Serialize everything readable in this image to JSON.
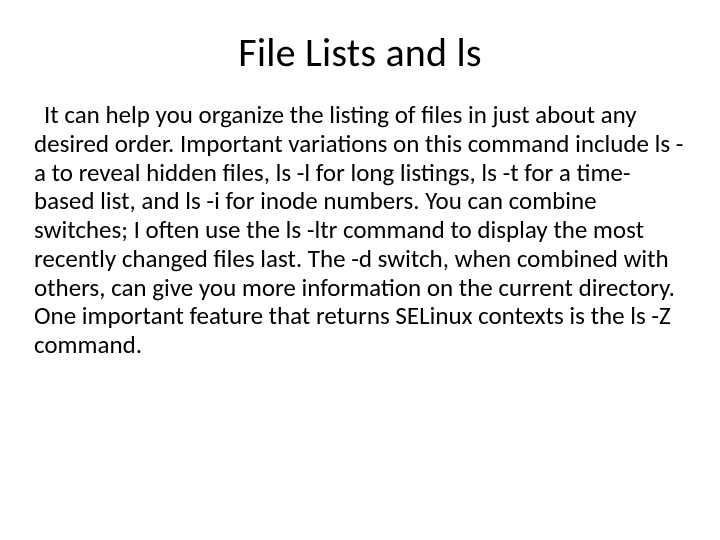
{
  "title": "File Lists and ls",
  "para1": " It can help you organize the listing of files in just about any desired order. Important variations on this command include ls -a to reveal hidden files, ls -l for long listings, ls -t for a time-based list, and ls -i for inode numbers. You can combine switches; I often use the ls -ltr command to display the most recently changed files last. The -d switch, when combined with others, can give you more information on the current directory.",
  "para2": "One important feature that returns SELinux contexts is the ls -Z command."
}
